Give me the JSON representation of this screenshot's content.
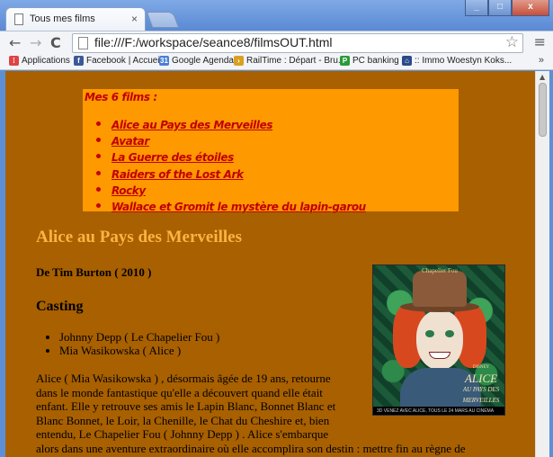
{
  "browser": {
    "tab_title": "Tous mes films",
    "tab_close": "×",
    "url": "file:///F:/workspace/seance8/filmsOUT.html",
    "window_buttons": [
      "_",
      "□",
      "x"
    ]
  },
  "bookmarks": [
    {
      "label": "Applications",
      "icon": "apps-grid-icon",
      "color": "#d44"
    },
    {
      "label": "Facebook | Accueil",
      "icon": "facebook-icon",
      "color": "#3b5998"
    },
    {
      "label": "Google Agenda",
      "icon": "calendar-icon",
      "color": "#4a7fd8"
    },
    {
      "label": "RailTime : Départ - Bru...",
      "icon": "railtime-icon",
      "color": "#d9a020"
    },
    {
      "label": "PC banking",
      "icon": "bank-icon",
      "color": "#2a9a3a"
    },
    {
      "label": ":: Immo Woestyn Koks...",
      "icon": "house-icon",
      "color": "#2a4a8a"
    }
  ],
  "bookmarks_more": "»",
  "films": {
    "heading": "Mes 6 films :",
    "items": [
      "Alice au Pays des Merveilles",
      "Avatar",
      "La Guerre des étoiles",
      "Raiders of the Lost Ark",
      "Rocky",
      "Wallace et Gromit le mystère du lapin-garou"
    ]
  },
  "film": {
    "title": "Alice au Pays des Merveilles",
    "director_line": "De Tim Burton ( 2010 )",
    "casting_heading": "Casting",
    "cast": [
      "Johnny Depp ( Le Chapelier Fou )",
      "Mia Wasikowska ( Alice )"
    ],
    "synopsis_lines": [
      "Alice ( Mia Wasikowska ) , désormais âgée de 19 ans, retourne",
      "dans le monde fantastique qu'elle a découvert quand elle était",
      "enfant. Elle y retrouve ses amis le Lapin Blanc, Bonnet Blanc et",
      "Blanc Bonnet, le Loir, la Chenille, le Chat du Cheshire et, bien",
      "entendu, Le Chapelier Fou ( Johnny Depp ) . Alice s'embarque",
      "alors dans une aventure extraordinaire où elle accomplira son destin : mettre fin au règne de"
    ],
    "poster": {
      "top_text": "Chapelier Fou",
      "logo_small": "DISNEY",
      "logo_main": "ALICE",
      "logo_sub": "AU PAYS DES MERVEILLES",
      "bottom_text": "3D  VENEZ AVEC ALICE, TOUS LE 24 MARS AU CINÉMA"
    }
  }
}
